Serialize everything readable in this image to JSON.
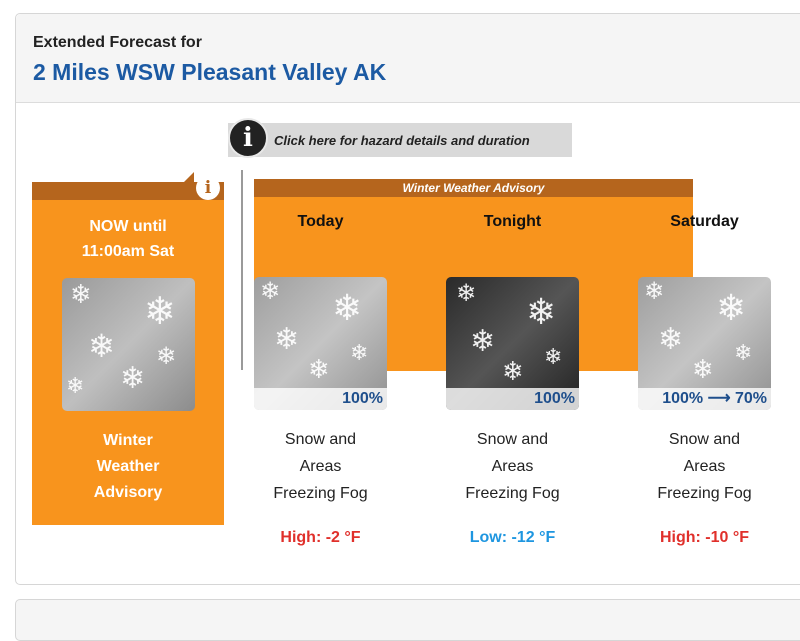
{
  "header": {
    "label": "Extended Forecast for",
    "location": "2 Miles WSW Pleasant Valley AK"
  },
  "hazard_link": {
    "icon": "info-icon",
    "text": "Click here for hazard details and duration"
  },
  "advisory_banner": "Winter Weather Advisory",
  "now": {
    "title_line1": "NOW until",
    "title_line2": "11:00am Sat",
    "label_line1": "Winter",
    "label_line2": "Weather",
    "label_line3": "Advisory",
    "icon": "info-icon"
  },
  "forecast": [
    {
      "period": "Today",
      "pop": "100%",
      "desc_line1": "Snow and",
      "desc_line2": "Areas",
      "desc_line3": "Freezing Fog",
      "temp": "High: -2 °F",
      "temp_color": "#e0302b",
      "image": "snow-day"
    },
    {
      "period": "Tonight",
      "pop": "100%",
      "desc_line1": "Snow and",
      "desc_line2": "Areas",
      "desc_line3": "Freezing Fog",
      "temp": "Low: -12 °F",
      "temp_color": "#1e96e0",
      "image": "snow-night"
    },
    {
      "period": "Saturday",
      "pop": "100% ⟶ 70%",
      "desc_line1": "Snow and",
      "desc_line2": "Areas",
      "desc_line3": "Freezing Fog",
      "temp": "High: -10 °F",
      "temp_color": "#e0302b",
      "image": "snow-day"
    }
  ],
  "colors": {
    "advisory_orange": "#f8941d",
    "advisory_brown": "#b5651d",
    "location_blue": "#1c5aa3"
  }
}
